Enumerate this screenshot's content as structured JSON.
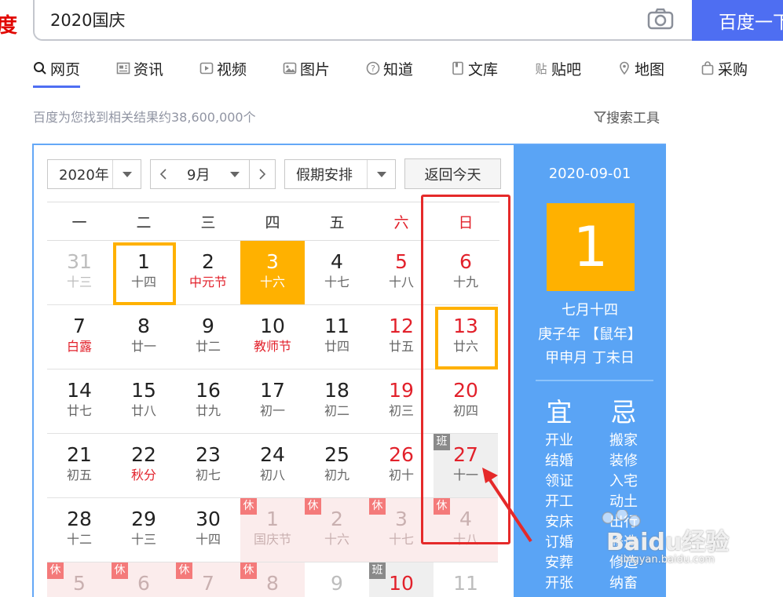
{
  "logo_fragment": "度",
  "search": {
    "query": "2020国庆",
    "button_label": "百度一下"
  },
  "tabs": [
    {
      "label": "网页",
      "icon": "search-icon",
      "active": true
    },
    {
      "label": "资讯",
      "icon": "news-icon"
    },
    {
      "label": "视频",
      "icon": "video-icon"
    },
    {
      "label": "图片",
      "icon": "image-icon"
    },
    {
      "label": "知道",
      "icon": "question-icon"
    },
    {
      "label": "文库",
      "icon": "document-icon"
    },
    {
      "label": "贴吧",
      "icon": "tieba-icon"
    },
    {
      "label": "地图",
      "icon": "map-icon"
    },
    {
      "label": "采购",
      "icon": "bag-icon"
    }
  ],
  "result_count": "百度为您找到相关结果约38,600,000个",
  "search_tools": "搜索工具",
  "calendar": {
    "year_select": "2020年",
    "month_select": "9月",
    "holiday_select": "假期安排",
    "today_button": "返回今天",
    "weekdays": [
      "一",
      "二",
      "三",
      "四",
      "五",
      "六",
      "日"
    ],
    "weeks": [
      [
        {
          "d": "31",
          "l": "十三",
          "other": true
        },
        {
          "d": "1",
          "l": "十四",
          "selected": true
        },
        {
          "d": "2",
          "l": "中元节",
          "lred": true
        },
        {
          "d": "3",
          "l": "十六",
          "today": true
        },
        {
          "d": "4",
          "l": "十七"
        },
        {
          "d": "5",
          "l": "十八"
        },
        {
          "d": "6",
          "l": "十九"
        }
      ],
      [
        {
          "d": "7",
          "l": "白露",
          "lred": true
        },
        {
          "d": "8",
          "l": "廿一"
        },
        {
          "d": "9",
          "l": "廿二"
        },
        {
          "d": "10",
          "l": "教师节",
          "lred": true
        },
        {
          "d": "11",
          "l": "廿四"
        },
        {
          "d": "12",
          "l": "廿五"
        },
        {
          "d": "13",
          "l": "廿六",
          "selected": true
        }
      ],
      [
        {
          "d": "14",
          "l": "廿七"
        },
        {
          "d": "15",
          "l": "廿八"
        },
        {
          "d": "16",
          "l": "廿九"
        },
        {
          "d": "17",
          "l": "初一"
        },
        {
          "d": "18",
          "l": "初二"
        },
        {
          "d": "19",
          "l": "初三"
        },
        {
          "d": "20",
          "l": "初四"
        }
      ],
      [
        {
          "d": "21",
          "l": "初五"
        },
        {
          "d": "22",
          "l": "秋分",
          "lred": true
        },
        {
          "d": "23",
          "l": "初七"
        },
        {
          "d": "24",
          "l": "初八"
        },
        {
          "d": "25",
          "l": "初九"
        },
        {
          "d": "26",
          "l": "初十"
        },
        {
          "d": "27",
          "l": "十一",
          "badge": "班"
        }
      ],
      [
        {
          "d": "28",
          "l": "十二"
        },
        {
          "d": "29",
          "l": "十三"
        },
        {
          "d": "30",
          "l": "十四"
        },
        {
          "d": "1",
          "l": "国庆节",
          "badge": "休",
          "holiday": true
        },
        {
          "d": "2",
          "l": "十六",
          "badge": "休",
          "holiday": true
        },
        {
          "d": "3",
          "l": "十七",
          "badge": "休",
          "holiday": true
        },
        {
          "d": "4",
          "l": "十八",
          "badge": "休",
          "holiday": true
        }
      ],
      [
        {
          "d": "5",
          "l": "",
          "badge": "休",
          "holiday": true
        },
        {
          "d": "6",
          "l": "",
          "badge": "休",
          "holiday": true
        },
        {
          "d": "7",
          "l": "",
          "badge": "休",
          "holiday": true
        },
        {
          "d": "8",
          "l": "",
          "badge": "休",
          "holiday": true
        },
        {
          "d": "9",
          "l": "",
          "other": true
        },
        {
          "d": "10",
          "l": "",
          "badge": "班"
        },
        {
          "d": "11",
          "l": "",
          "other": true
        }
      ]
    ]
  },
  "detail": {
    "date": "2020-09-01",
    "big_day": "1",
    "lunar": "七月十四",
    "ganzhi_year": "庚子年 【鼠年】",
    "ganzhi_day": "甲申月 丁未日",
    "yi_title": "宜",
    "ji_title": "忌",
    "yi": [
      "开业",
      "结婚",
      "领证",
      "开工",
      "安床",
      "订婚",
      "安葬",
      "开张"
    ],
    "ji": [
      "搬家",
      "装修",
      "入宅",
      "动土",
      "出行",
      "修造",
      "修造",
      "纳畜"
    ]
  },
  "watermark": {
    "brand": "Baidu经验",
    "url": "jingyan.baidu.com"
  },
  "colors": {
    "accent": "#4e6ef2",
    "today": "#ffb100",
    "weekend": "#e2212b",
    "panel": "#5aa4f5",
    "annotation": "#e52a2a"
  }
}
